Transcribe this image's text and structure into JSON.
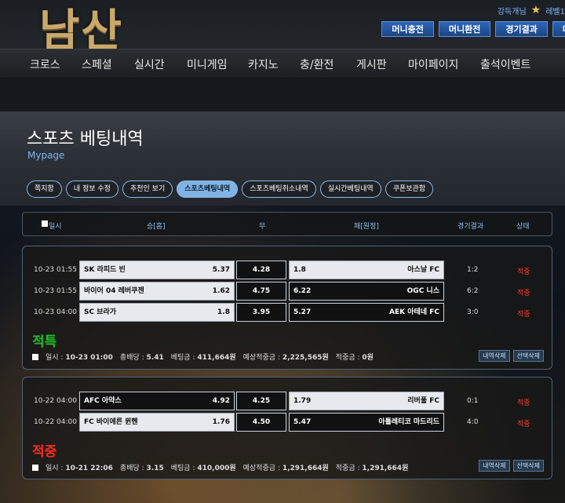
{
  "header": {
    "logo": "남산",
    "user_name": "강득개님",
    "level": "레벨1",
    "buttons": [
      "머니충전",
      "머니환전",
      "경기결과",
      "마"
    ]
  },
  "nav": [
    "크로스",
    "스페셜",
    "실시간",
    "미니게임",
    "카지노",
    "충/환전",
    "게시판",
    "마이페이지",
    "출석이벤트"
  ],
  "page": {
    "title": "스포츠 베팅내역",
    "subtitle": "Mypage",
    "tabs": [
      "쪽지함",
      "내 정보 수정",
      "추천인 보기",
      "스포츠베팅내역",
      "스포츠베팅취소내역",
      "실시간베팅내역",
      "쿠폰보관함"
    ],
    "active_tab": 3
  },
  "table_header": [
    "일시",
    "승[홈]",
    "무",
    "패[원정]",
    "경기결과",
    "상태"
  ],
  "bets": [
    {
      "rows": [
        {
          "time": "10-23 01:55",
          "home": "SK 라피드 빈",
          "home_odd": "5.37",
          "draw_odd": "4.28",
          "away": "아스날 FC",
          "away_odd": "1.8",
          "result": "1:2",
          "status": "적중",
          "selected": "away"
        },
        {
          "time": "10-23 01:55",
          "home": "바이어 04 레버쿠젠",
          "home_odd": "1.62",
          "draw_odd": "4.75",
          "away": "OGC 니스",
          "away_odd": "6.22",
          "result": "6:2",
          "status": "적중",
          "selected": "home"
        },
        {
          "time": "10-23 04:00",
          "home": "SC 브라가",
          "home_odd": "1.8",
          "draw_odd": "3.95",
          "away": "AEK 아테네 FC",
          "away_odd": "5.27",
          "result": "3:0",
          "status": "적중",
          "selected": "home"
        }
      ],
      "verdict": "적특",
      "verdict_color": "#1fbf2a",
      "summary": {
        "date_label": "일시 :",
        "date": "10-23 01:00",
        "odds_label": "총배당 :",
        "odds": "5.41",
        "stake_label": "베팅금 :",
        "stake": "411,664원",
        "expected_label": "예상적중금 :",
        "expected": "2,225,565원",
        "win_label": "적중금 :",
        "win": "0원"
      },
      "actions": [
        "내역삭제",
        "선택삭제"
      ]
    },
    {
      "rows": [
        {
          "time": "10-22 04:00",
          "home": "AFC 아약스",
          "home_odd": "4.92",
          "draw_odd": "4.25",
          "away": "리버풀 FC",
          "away_odd": "1.79",
          "result": "0:1",
          "status": "적중",
          "selected": "away"
        },
        {
          "time": "10-22 04:00",
          "home": "FC 바이에른 뮌헨",
          "home_odd": "1.76",
          "draw_odd": "4.50",
          "away": "아틀레티코 마드리드",
          "away_odd": "5.47",
          "result": "4:0",
          "status": "적중",
          "selected": "home"
        }
      ],
      "verdict": "적중",
      "verdict_color": "#ff2a1f",
      "summary": {
        "date_label": "일시 :",
        "date": "10-21 22:06",
        "odds_label": "총배당 :",
        "odds": "3.15",
        "stake_label": "베팅금 :",
        "stake": "410,000원",
        "expected_label": "예상적중금 :",
        "expected": "1,291,664원",
        "win_label": "적중금 :",
        "win": "1,291,664원"
      },
      "actions": [
        "내역삭제",
        "선택삭제"
      ]
    }
  ]
}
